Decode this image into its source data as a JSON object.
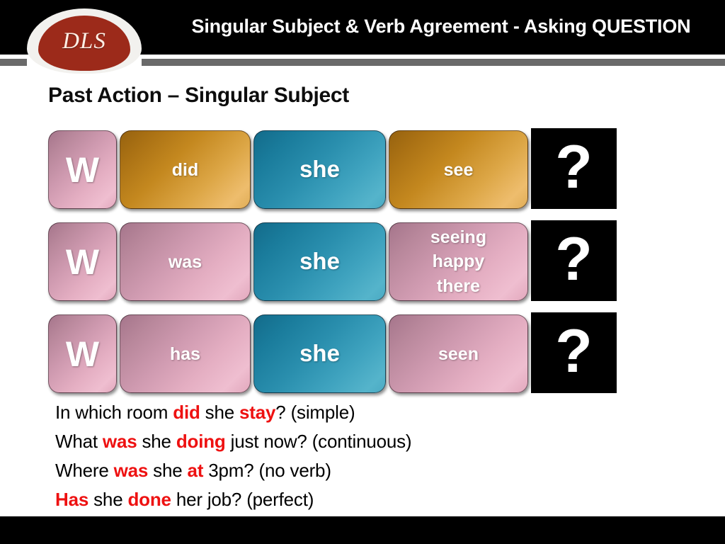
{
  "header": {
    "title": "Singular Subject & Verb Agreement - Asking QUESTION",
    "logo_text": "DLS",
    "bar_color": "#000000",
    "rule_color": "#6a6a6a",
    "logo_color": "#9c2a1a"
  },
  "section": {
    "heading": "Past Action – Singular Subject"
  },
  "colors": {
    "pink": "#cf9ab0",
    "gold": "#c4881f",
    "teal": "#2a8fae",
    "black": "#000000",
    "highlight_red": "#ee1111"
  },
  "grid": {
    "question_mark": "?",
    "rows": [
      {
        "wh": "W",
        "wh_color": "pink",
        "auxiliary": "did",
        "auxiliary_color": "gold",
        "subject": "she",
        "subject_color": "teal",
        "verb": "see",
        "verb_color": "gold",
        "verb_lines": [
          "see"
        ]
      },
      {
        "wh": "W",
        "wh_color": "pink",
        "auxiliary": "was",
        "auxiliary_color": "pink",
        "subject": "she",
        "subject_color": "teal",
        "verb": "seeing happy there",
        "verb_color": "pink",
        "verb_lines": [
          "seeing",
          "happy",
          "there"
        ]
      },
      {
        "wh": "W",
        "wh_color": "pink",
        "auxiliary": "has",
        "auxiliary_color": "pink",
        "subject": "she",
        "subject_color": "teal",
        "verb": "seen",
        "verb_color": "pink",
        "verb_lines": [
          "seen"
        ]
      }
    ]
  },
  "examples": [
    {
      "parts": [
        {
          "text": "In which room ",
          "highlight": false
        },
        {
          "text": "did",
          "highlight": true
        },
        {
          "text": " she ",
          "highlight": false
        },
        {
          "text": "stay",
          "highlight": true
        },
        {
          "text": "? (simple)",
          "highlight": false
        }
      ]
    },
    {
      "parts": [
        {
          "text": "What ",
          "highlight": false
        },
        {
          "text": "was",
          "highlight": true
        },
        {
          "text": " she ",
          "highlight": false
        },
        {
          "text": "doing",
          "highlight": true
        },
        {
          "text": " just now? (continuous)",
          "highlight": false
        }
      ]
    },
    {
      "parts": [
        {
          "text": "Where ",
          "highlight": false
        },
        {
          "text": "was",
          "highlight": true
        },
        {
          "text": " she ",
          "highlight": false
        },
        {
          "text": "at",
          "highlight": true
        },
        {
          "text": " 3pm? (no verb)",
          "highlight": false
        }
      ]
    },
    {
      "parts": [
        {
          "text": "Has",
          "highlight": true
        },
        {
          "text": " she ",
          "highlight": false
        },
        {
          "text": "done",
          "highlight": true
        },
        {
          "text": " her job? (perfect)",
          "highlight": false
        }
      ]
    }
  ]
}
